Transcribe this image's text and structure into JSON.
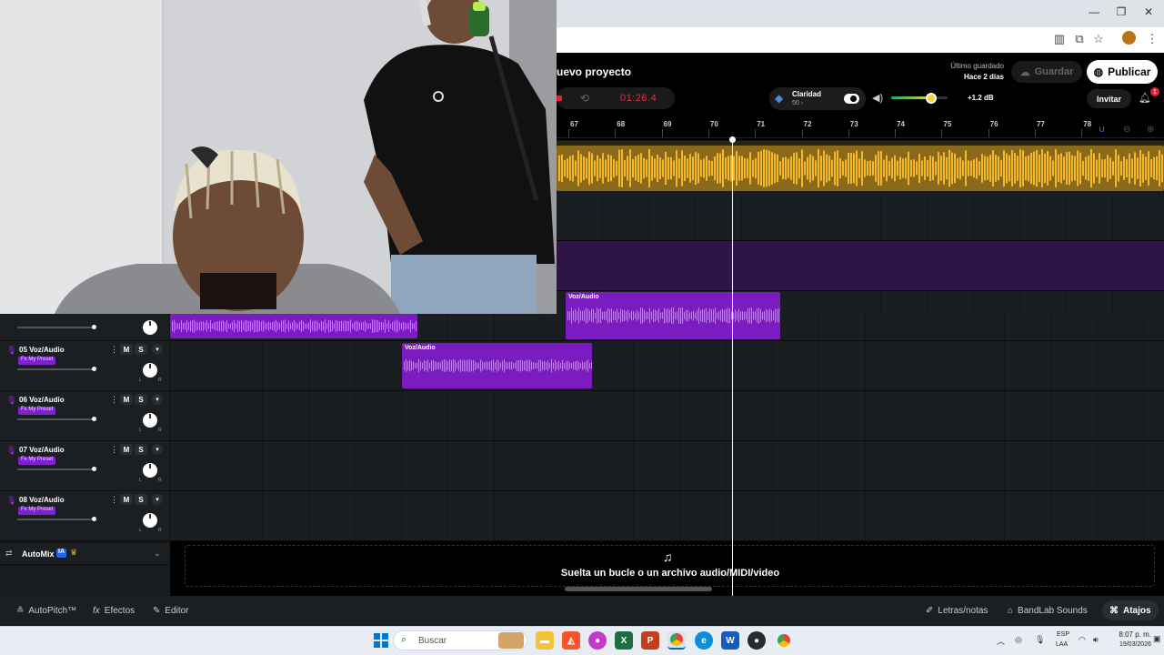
{
  "browser": {
    "window_controls": {
      "minimize": "—",
      "maximize": "❐",
      "close": "✕"
    }
  },
  "project": {
    "title": "uevo proyecto",
    "saved_label": "Último guardado",
    "saved_value": "Hace 2 días",
    "save_label": "Guardar",
    "publish_label": "Publicar"
  },
  "transport": {
    "timecode": "01:26.4"
  },
  "clarity": {
    "label": "Claridad",
    "value": "50 ›",
    "enabled": true
  },
  "master_volume": {
    "level": 0.71,
    "db": "+1.2 dB"
  },
  "invite_label": "Invitar",
  "notifications": {
    "count": "1"
  },
  "ruler": {
    "ticks": [
      "67",
      "68",
      "69",
      "70",
      "71",
      "72",
      "73",
      "74",
      "75",
      "76",
      "77",
      "78"
    ]
  },
  "playhead": {
    "position_bar": 70.35
  },
  "clips": [
    {
      "lane": "top",
      "label": "",
      "color": "#f5b82a"
    },
    {
      "lane": "purple-empty",
      "label": "",
      "color": "#4b1a7a"
    },
    {
      "lane": "04",
      "label": "Voz/Audio",
      "color": "#8b1fd6"
    },
    {
      "lane": "04-left",
      "label": "",
      "color": "#8b1fd6"
    },
    {
      "lane": "05",
      "label": "Voz/Audio",
      "color": "#8b1fd6"
    }
  ],
  "tracks": [
    {
      "name": "05 Voz/Audio",
      "fx": "Fx My Preset",
      "mute": "M",
      "solo": "S",
      "volume": 0.97,
      "pan_l": "L",
      "pan_r": "R"
    },
    {
      "name": "06 Voz/Audio",
      "fx": "Fx My Preset",
      "mute": "M",
      "solo": "S",
      "volume": 0.97,
      "pan_l": "L",
      "pan_r": "R"
    },
    {
      "name": "07 Voz/Audio",
      "fx": "Fx My Preset",
      "mute": "M",
      "solo": "S",
      "volume": 0.97,
      "pan_l": "L",
      "pan_r": "R"
    },
    {
      "name": "08 Voz/Audio",
      "fx": "Fx My Preset",
      "mute": "M",
      "solo": "S",
      "volume": 0.97,
      "pan_l": "L",
      "pan_r": "R"
    }
  ],
  "automix": {
    "label": "AutoMix",
    "badge": "IA"
  },
  "dropzone": {
    "text": "Suelta un bucle o un archivo audio/MIDI/video"
  },
  "bottom_toolbar": {
    "autopitch": "AutoPitch™",
    "effects": "Efectos",
    "editor": "Editor",
    "lyrics": "Letras/notas",
    "sounds": "BandLab Sounds",
    "shortcuts": "Atajos"
  },
  "taskbar": {
    "search_placeholder": "Buscar",
    "lang_top": "ESP",
    "lang_bottom": "LAA",
    "time": "8:07 p. m.",
    "date": "19/03/2026",
    "apps": [
      "windows-start",
      "search",
      "photo",
      "file-explorer",
      "brave",
      "firefox",
      "excel",
      "powerpoint",
      "chrome",
      "edge",
      "word",
      "obs",
      "chrome-profile"
    ]
  },
  "colors": {
    "accent_purple": "#8b1fd6",
    "accent_yellow": "#f5b82a",
    "record_red": "#e03048"
  }
}
